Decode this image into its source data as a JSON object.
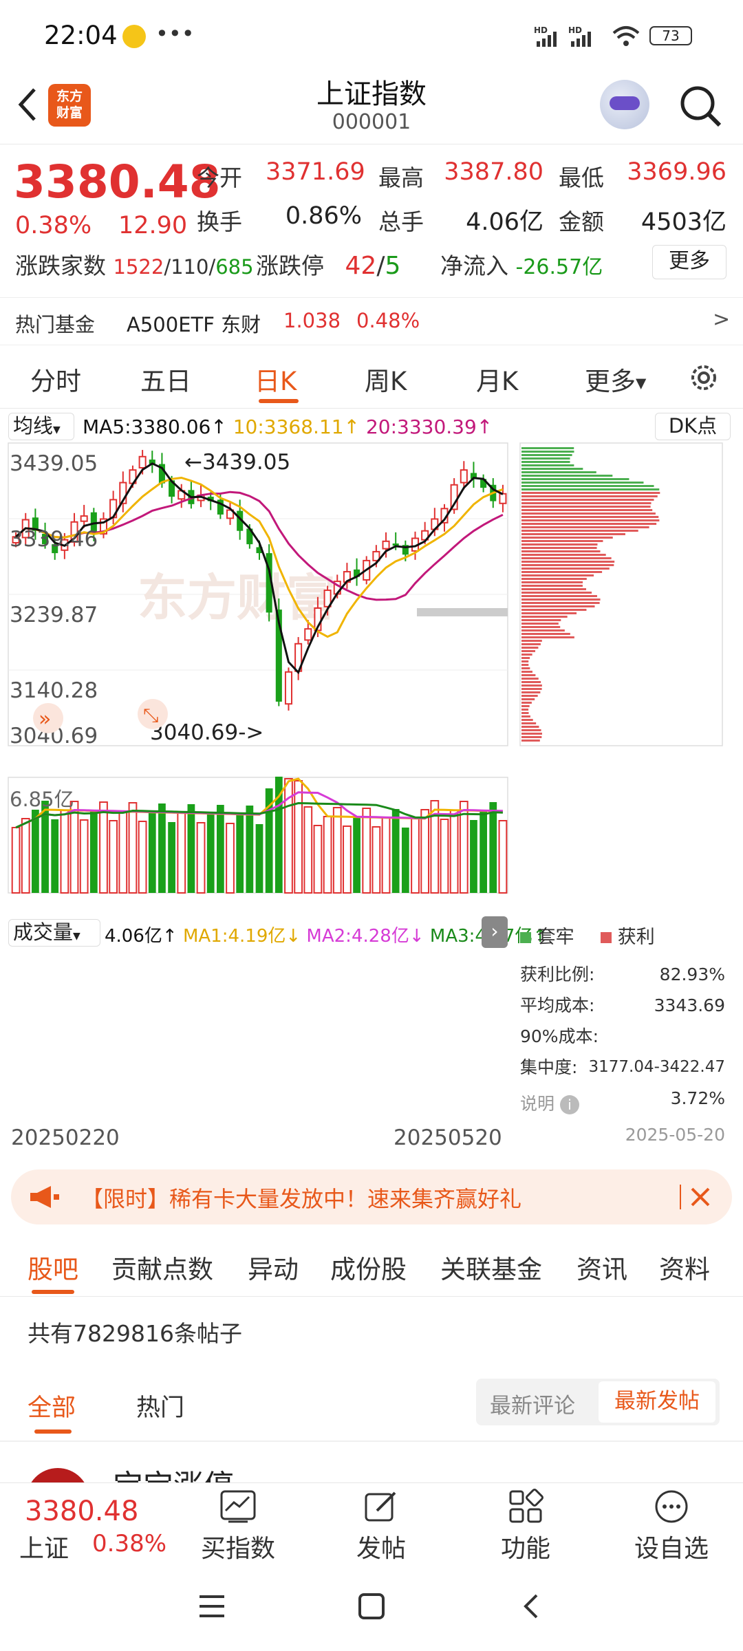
{
  "statusbar": {
    "time": "22:04",
    "battery": "73",
    "signal1": "HD",
    "signal2": "HD"
  },
  "header": {
    "title": "上证指数",
    "code": "000001",
    "logo_text": "东方\n财富"
  },
  "quote": {
    "price": "3380.48",
    "change_pct": "0.38%",
    "change": "12.90",
    "open_label": "今开",
    "open": "3371.69",
    "high_label": "最高",
    "high": "3387.80",
    "low_label": "最低",
    "low": "3369.96",
    "turnover_label": "换手",
    "turnover": "0.86%",
    "volume_label": "总手",
    "volume": "4.06亿",
    "amount_label": "金额",
    "amount": "4503亿",
    "breadth_label": "涨跌家数",
    "breadth_up": "1522",
    "breadth_flat": "110",
    "breadth_down": "685",
    "limit_label": "涨跌停",
    "limit_up": "42",
    "limit_down": "5",
    "inflow_label": "净流入",
    "inflow": "-26.57亿",
    "more_button": "更多"
  },
  "hotfund": {
    "label": "热门基金",
    "name": "A500ETF 东财",
    "price": "1.038",
    "pct": "0.48%",
    "arrow": ">"
  },
  "ktabs": [
    "分时",
    "五日",
    "日K",
    "周K",
    "月K",
    "更多"
  ],
  "ktab_active": 2,
  "chart": {
    "ma_select": "均线",
    "ma5": "MA5:3380.06↑",
    "ma10": "10:3368.11↑",
    "ma20": "20:3330.39↑",
    "dk_button": "DK点",
    "y_labels": [
      "3439.05",
      "3339.46",
      "3239.87",
      "3140.28",
      "3040.69"
    ],
    "high_mark": "←3439.05",
    "low_mark": "3040.69->",
    "watermark": "东方财富",
    "vol_select": "成交量",
    "vol_total": "4.06亿↑",
    "vol_ma1": "MA1:4.19亿↓",
    "vol_ma2": "MA2:4.28亿↓",
    "vol_ma3": "MA3:4.17亿↑",
    "vol_axis": "6.85亿",
    "date_start": "20250220",
    "date_end": "20250520",
    "colors": {
      "up": "#e03131",
      "down": "#1aa01a",
      "ma5": "#111111",
      "ma10": "#f0b400",
      "ma20": "#c2187a"
    }
  },
  "chip": {
    "legend_locked": "套牢",
    "legend_profit": "获利",
    "profit_ratio_label": "获利比例:",
    "profit_ratio": "82.93%",
    "avg_cost_label": "平均成本:",
    "avg_cost": "3343.69",
    "cost90_label": "90%成本:",
    "cost90": "3177.04-3422.47",
    "concentration_label": "集中度:",
    "concentration": "3.72%",
    "note_label": "说明",
    "date": "2025-05-20"
  },
  "banner": {
    "text": "【限时】稀有卡大量发放中！速来集齐赢好礼"
  },
  "subtabs": [
    "股吧",
    "贡献点数",
    "异动",
    "成份股",
    "关联基金",
    "资讯",
    "资料"
  ],
  "posts": {
    "count_text": "共有7829816条帖子",
    "filter_all": "全部",
    "filter_hot": "热门",
    "sort_latest_comment": "最新评论",
    "sort_latest_post": "最新发帖",
    "peek_text": "宝宝涨停"
  },
  "bottombar": {
    "price": "3380.48",
    "name": "上证",
    "pct": "0.38%",
    "buy": "买指数",
    "post": "发帖",
    "func": "功能",
    "watch": "设自选"
  }
}
